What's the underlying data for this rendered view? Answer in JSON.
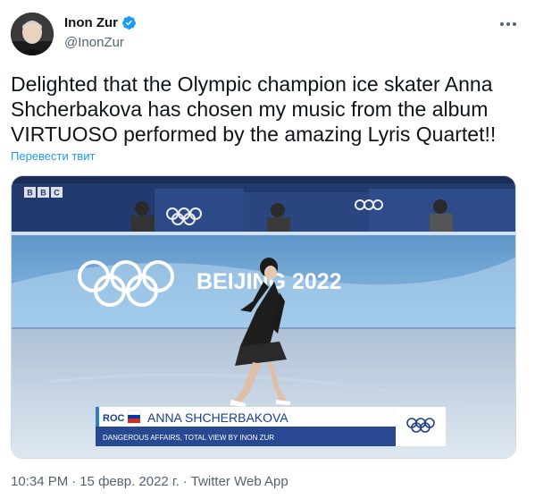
{
  "author": {
    "name": "Inon Zur",
    "handle": "@InonZur",
    "verified": true
  },
  "icons": {
    "more": "more-horizontal-icon",
    "verified": "verified-badge-icon"
  },
  "tweet": {
    "text": "Delighted that the Olympic champion ice skater Anna Shcherbakova has chosen my music from the album VIRTUOSO performed by the amazing Lyris Quartet!!",
    "translate_label": "Перевести твит"
  },
  "media": {
    "broadcaster": "BBC",
    "broadcaster_sub": "BEIJING 2022",
    "arena_banner": "BEIJING 2022",
    "lower_third_country": "ROC",
    "lower_third_name": "ANNA SHCHERBAKOVA",
    "lower_third_caption": "DANGEROUS AFFAIRS, TOTAL VIEW BY INON ZUR"
  },
  "meta": {
    "time": "10:34 PM",
    "date": "15 февр. 2022 г.",
    "source": "Twitter Web App",
    "separator": "·"
  },
  "colors": {
    "link": "#1d9bf0",
    "secondary_text": "#536471",
    "verified": "#1d9bf0"
  }
}
